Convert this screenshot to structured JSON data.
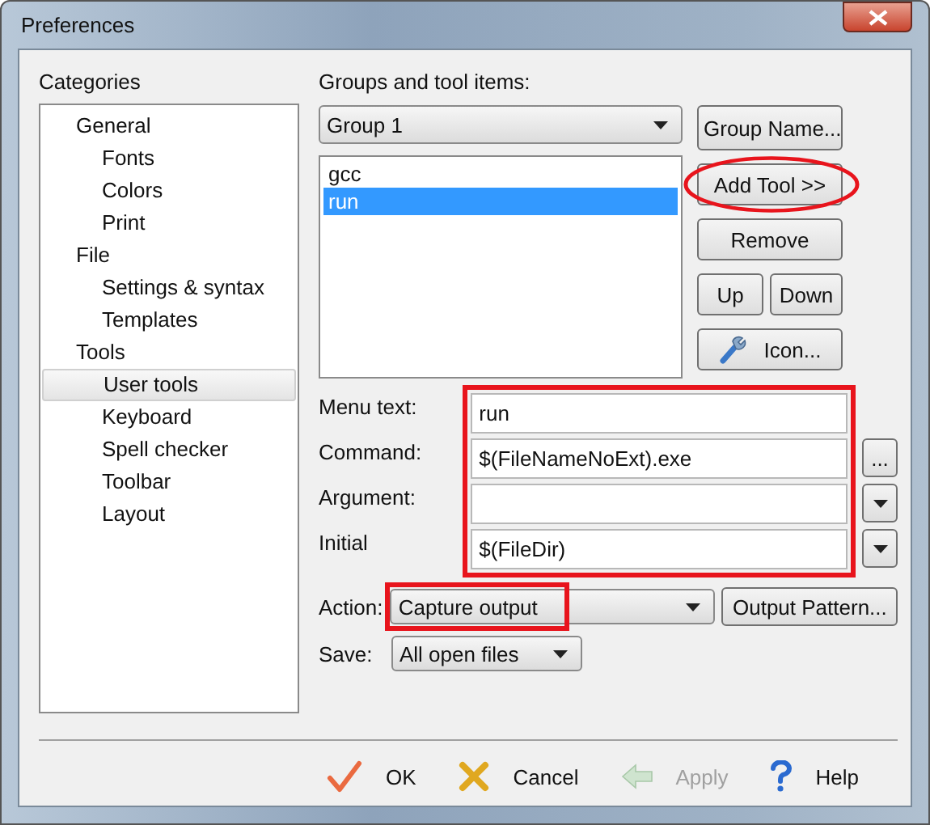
{
  "window": {
    "title": "Preferences"
  },
  "categories": {
    "label": "Categories",
    "items": [
      {
        "label": "General",
        "selected": false,
        "children": [
          {
            "label": "Fonts",
            "selected": false
          },
          {
            "label": "Colors",
            "selected": false
          },
          {
            "label": "Print",
            "selected": false
          }
        ]
      },
      {
        "label": "File",
        "selected": false,
        "children": [
          {
            "label": "Settings & syntax",
            "selected": false
          },
          {
            "label": "Templates",
            "selected": false
          }
        ]
      },
      {
        "label": "Tools",
        "selected": false,
        "children": [
          {
            "label": "User tools",
            "selected": true
          },
          {
            "label": "Keyboard",
            "selected": false
          },
          {
            "label": "Spell checker",
            "selected": false
          },
          {
            "label": "Toolbar",
            "selected": false
          },
          {
            "label": "Layout",
            "selected": false
          }
        ]
      }
    ]
  },
  "groups": {
    "label": "Groups and tool items:",
    "group_select": {
      "value": "Group 1"
    },
    "tools": [
      {
        "label": "gcc",
        "selected": false
      },
      {
        "label": "run",
        "selected": true
      }
    ],
    "buttons": [
      {
        "label": "Group Name...",
        "circled": false
      },
      {
        "label": "Add Tool >>",
        "circled": true
      },
      {
        "label": "Remove",
        "circled": false
      }
    ],
    "up": "Up",
    "down": "Down",
    "icon_button": "Icon..."
  },
  "fields": {
    "highlighted": true,
    "rows": [
      {
        "label": "Menu text:",
        "value": "run",
        "kind": "plain"
      },
      {
        "label": "Command:",
        "value": "$(FileNameNoExt).exe",
        "kind": "browse",
        "side_label": "..."
      },
      {
        "label": "Argument:",
        "kind": "dropdown"
      },
      {
        "label": "Initial",
        "value": "$(FileDir)",
        "kind": "dropdown"
      }
    ]
  },
  "action": {
    "label": "Action:",
    "value": "Capture output",
    "highlighted": true,
    "button": "Output Pattern..."
  },
  "save": {
    "label": "Save:",
    "value": "All open files"
  },
  "footer_buttons": [
    {
      "kind": "ok",
      "label": "OK",
      "disabled": false
    },
    {
      "kind": "cancel",
      "label": "Cancel",
      "disabled": false
    },
    {
      "kind": "apply",
      "label": "Apply",
      "disabled": true
    },
    {
      "kind": "help",
      "label": "Help",
      "disabled": false
    }
  ]
}
